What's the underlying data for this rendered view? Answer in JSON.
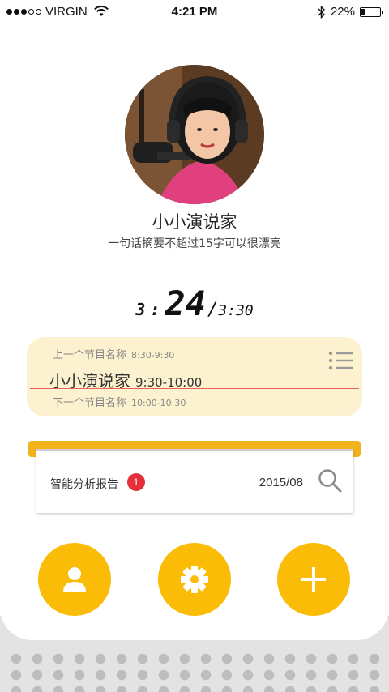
{
  "status_bar": {
    "carrier": "VIRGIN",
    "time": "4:21 PM",
    "battery": "22%",
    "battery_level": 0.22,
    "signal_bars": 3,
    "icons": [
      "signal-icon",
      "wifi-icon",
      "bluetooth-icon",
      "battery-icon"
    ]
  },
  "profile": {
    "name": "小小演说家",
    "tagline": "一句话摘要不超过15字可以很漂亮",
    "avatar": "host-photo"
  },
  "timer": {
    "hours": "3",
    "separator": ":",
    "minutes": "24",
    "slash": "/",
    "total": "3:30"
  },
  "program": {
    "previous": {
      "label": "上一个节目名称",
      "time": "8:30-9:30"
    },
    "current": {
      "label": "小小演说家",
      "time": "9:30-10:00"
    },
    "next": {
      "label": "下一个节目名称",
      "time": "10:00-10:30"
    },
    "menu_icon": "list-icon"
  },
  "report": {
    "title": "智能分析报告",
    "badge": "1",
    "date": "2015/08",
    "search_icon": "search-icon"
  },
  "actions": [
    {
      "icon": "user-icon"
    },
    {
      "icon": "gear-icon"
    },
    {
      "icon": "plus-icon"
    }
  ],
  "colors": {
    "accent": "#fbbc08",
    "program_card": "#fdf2cf",
    "badge": "#e5303a",
    "divider": "#e5615a"
  }
}
